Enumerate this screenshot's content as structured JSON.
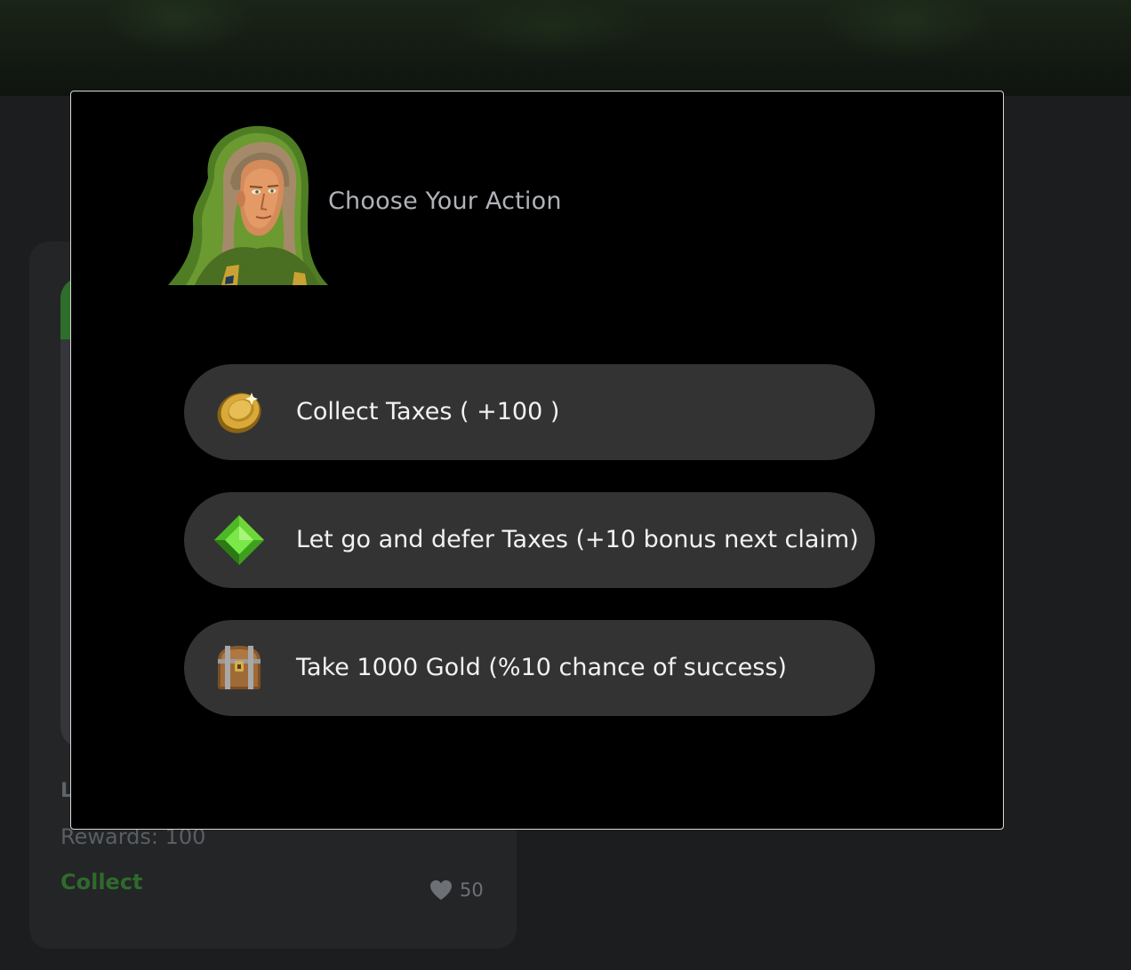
{
  "background_card": {
    "title_fragment": "L",
    "rewards": "Rewards: 100",
    "collect_label": "Collect",
    "like_count": "50",
    "like_icon": "heart-icon"
  },
  "modal": {
    "title": "Choose Your Action",
    "portrait": "hooded-character-portrait",
    "options": [
      {
        "label": "Collect Taxes ( +100 )",
        "icon": "gold-coin-icon"
      },
      {
        "label": "Let go and defer Taxes (+10 bonus next claim)",
        "icon": "green-gem-icon"
      },
      {
        "label": "Take 1000 Gold (%10 chance of success)",
        "icon": "treasure-chest-icon"
      }
    ]
  },
  "colors": {
    "page_background": "#1c1d1f",
    "modal_background": "#000000",
    "option_background": "#333333",
    "collect_green": "#2f6a2c"
  }
}
